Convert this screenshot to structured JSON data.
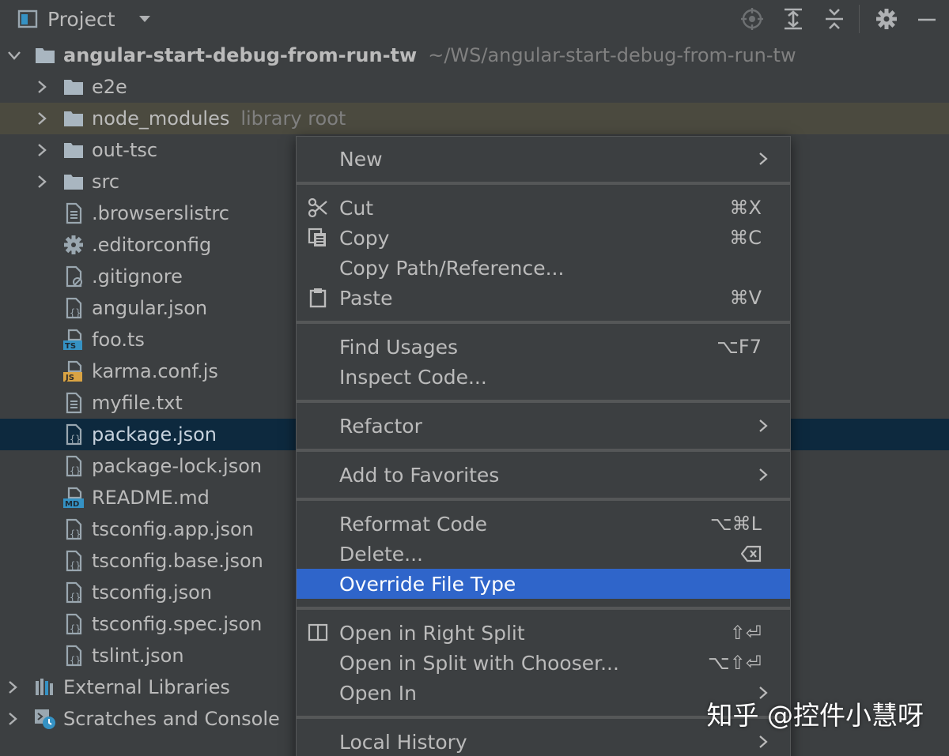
{
  "toolbar": {
    "title": "Project"
  },
  "tree": {
    "root": {
      "name": "angular-start-debug-from-run-tw",
      "path": "~/WS/angular-start-debug-from-run-tw"
    },
    "folders": [
      {
        "name": "e2e"
      },
      {
        "name": "node_modules",
        "hint": "library root"
      },
      {
        "name": "out-tsc"
      },
      {
        "name": "src"
      }
    ],
    "files": [
      {
        "name": ".browserslistrc",
        "icon": "text-file-icon"
      },
      {
        "name": ".editorconfig",
        "icon": "gear-icon"
      },
      {
        "name": ".gitignore",
        "icon": "ignore-file-icon"
      },
      {
        "name": "angular.json",
        "icon": "json-file-icon"
      },
      {
        "name": "foo.ts",
        "icon": "typescript-file-icon",
        "badge": "TS"
      },
      {
        "name": "karma.conf.js",
        "icon": "javascript-file-icon",
        "badge": "JS"
      },
      {
        "name": "myfile.txt",
        "icon": "text-file-icon"
      },
      {
        "name": "package.json",
        "icon": "json-file-icon"
      },
      {
        "name": "package-lock.json",
        "icon": "json-file-icon"
      },
      {
        "name": "README.md",
        "icon": "markdown-file-icon",
        "badge": "MD"
      },
      {
        "name": "tsconfig.app.json",
        "icon": "json-file-icon"
      },
      {
        "name": "tsconfig.base.json",
        "icon": "json-file-icon"
      },
      {
        "name": "tsconfig.json",
        "icon": "json-file-icon"
      },
      {
        "name": "tsconfig.spec.json",
        "icon": "json-file-icon"
      },
      {
        "name": "tslint.json",
        "icon": "json-file-icon"
      }
    ],
    "external_libraries": "External Libraries",
    "scratches": "Scratches and Console"
  },
  "menu": {
    "new": "New",
    "cut": "Cut",
    "cut_shortcut": "⌘X",
    "copy": "Copy",
    "copy_shortcut": "⌘C",
    "copy_path": "Copy Path/Reference...",
    "paste": "Paste",
    "paste_shortcut": "⌘V",
    "find_usages": "Find Usages",
    "find_usages_shortcut": "⌥F7",
    "inspect_code": "Inspect Code...",
    "refactor": "Refactor",
    "add_to_favorites": "Add to Favorites",
    "reformat_code": "Reformat Code",
    "reformat_code_shortcut": "⌥⌘L",
    "delete": "Delete...",
    "override_file_type": "Override File Type",
    "open_right_split": "Open in Right Split",
    "open_right_split_shortcut": "⇧⏎",
    "open_split_chooser": "Open in Split with Chooser...",
    "open_split_chooser_shortcut": "⌥⇧⏎",
    "open_in": "Open In",
    "local_history": "Local History"
  },
  "watermark": "知乎 @控件小慧呀",
  "colors": {
    "background": "#3c3f41",
    "selection": "#0d293e",
    "highlight_row": "#4b4a3f",
    "menu_active": "#2f65ca",
    "text": "#bbbbbb"
  }
}
